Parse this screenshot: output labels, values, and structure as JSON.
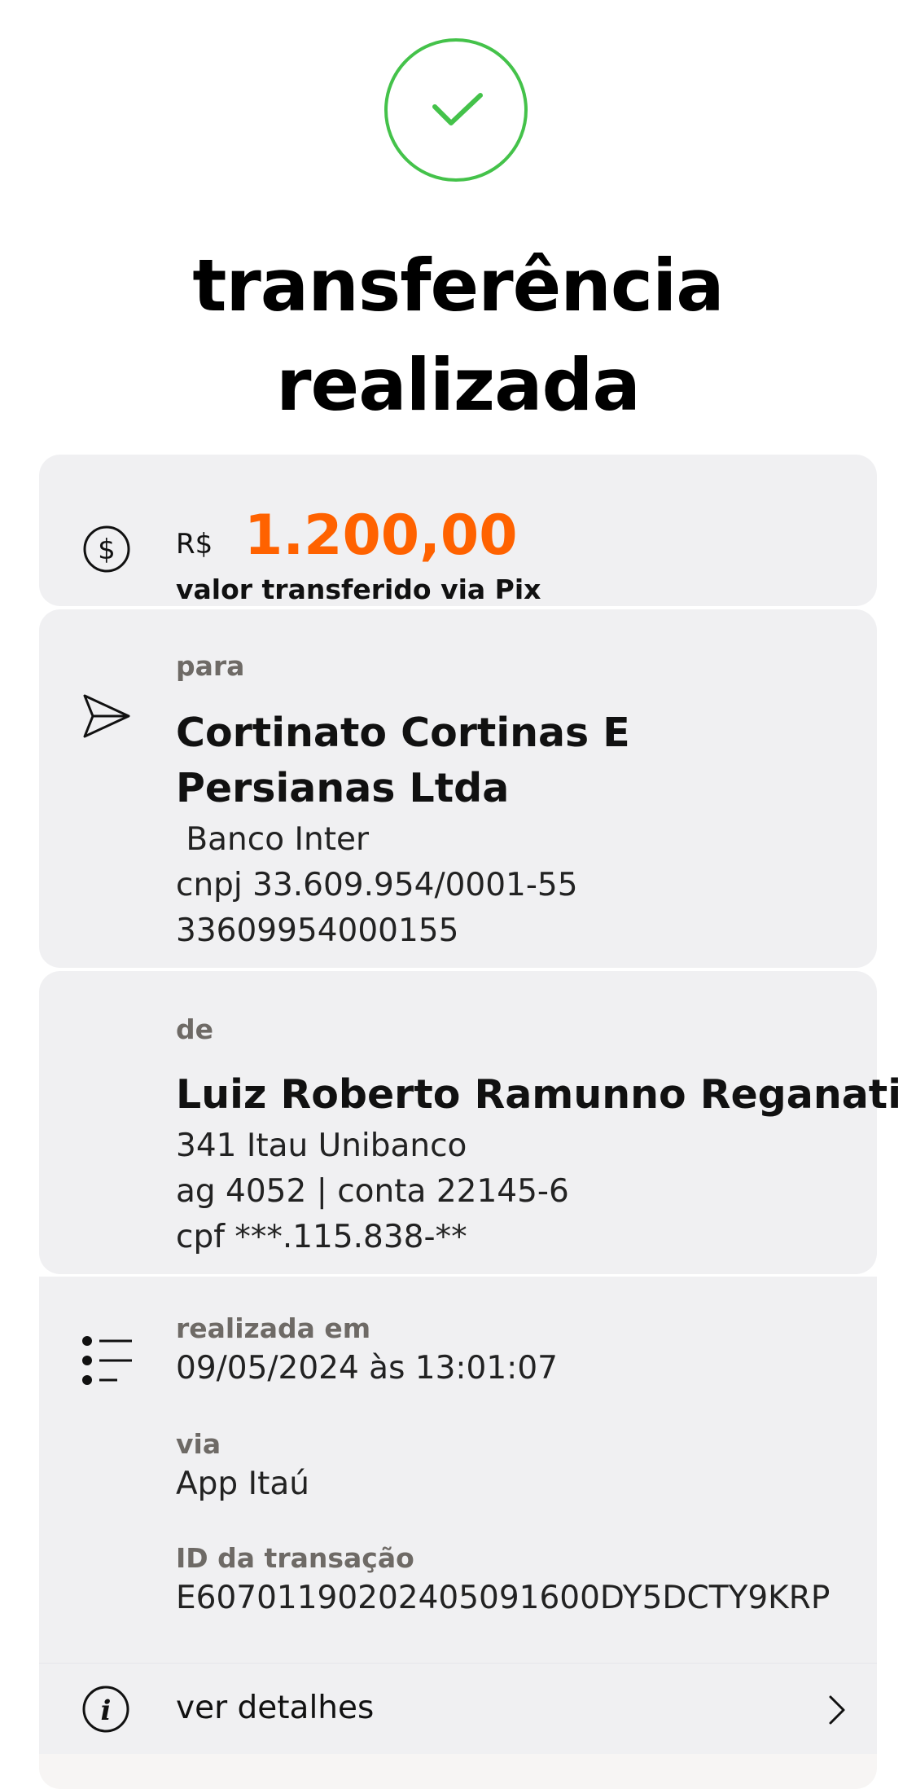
{
  "header": {
    "status_icon": "check-circle-icon",
    "title_line1": "transferência",
    "title_line2": "realizada"
  },
  "amount": {
    "icon": "dollar-circle-icon",
    "currency": "R$",
    "value": "1.200,00",
    "caption": "valor transferido via Pix"
  },
  "para": {
    "icon": "send-icon",
    "label": "para",
    "name_line1": "Cortinato Cortinas E",
    "name_line2": "Persianas Ltda",
    "bank": " Banco Inter",
    "cnpj": "cnpj 33.609.954/0001-55",
    "key": "33609954000155"
  },
  "de": {
    "label": "de",
    "name": "Luiz Roberto Ramunno Reganati",
    "bank": "341 Itau Unibanco",
    "account": "ag 4052 | conta 22145-6",
    "cpf": "cpf ***.115.838-**"
  },
  "info": {
    "icon": "list-icon",
    "date_label": "realizada em",
    "date_value": "09/05/2024 às 13:01:07",
    "via_label": "via",
    "via_value": "App Itaú",
    "id_label": "ID da transação",
    "id_value": "E60701190202405091600DY5DCTY9KRP"
  },
  "details": {
    "icon": "info-icon",
    "label": "ver detalhes",
    "chevron": "chevron-right-icon"
  },
  "colors": {
    "success": "#44c24a",
    "amount": "#ff6200",
    "card_bg": "#f0f0f2"
  }
}
